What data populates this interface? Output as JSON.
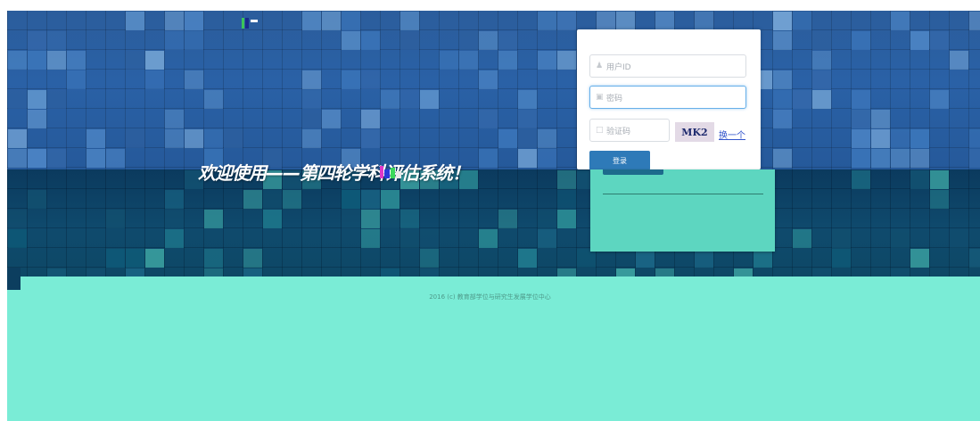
{
  "welcome": {
    "text": "欢迎使用——第四轮学科评估系统！"
  },
  "login": {
    "user_placeholder": "用户ID",
    "password_placeholder": "密码",
    "captcha_placeholder": "验证码",
    "captcha_text": "MK2",
    "refresh_label": "换一个",
    "submit_label": "登录"
  },
  "footer": {
    "copyright": "2016 (c) 教育部学位与研究生发展学位中心"
  },
  "colors": {
    "band_top": "#2a61a6",
    "band_bottom": "#0f4a6d",
    "footer": "#7aecd6",
    "accent_button": "#2e7ab8",
    "teal_card": "#5dd6c0"
  },
  "icons": {
    "user": "user-icon",
    "lock": "lock-icon",
    "captcha": "captcha-icon"
  }
}
